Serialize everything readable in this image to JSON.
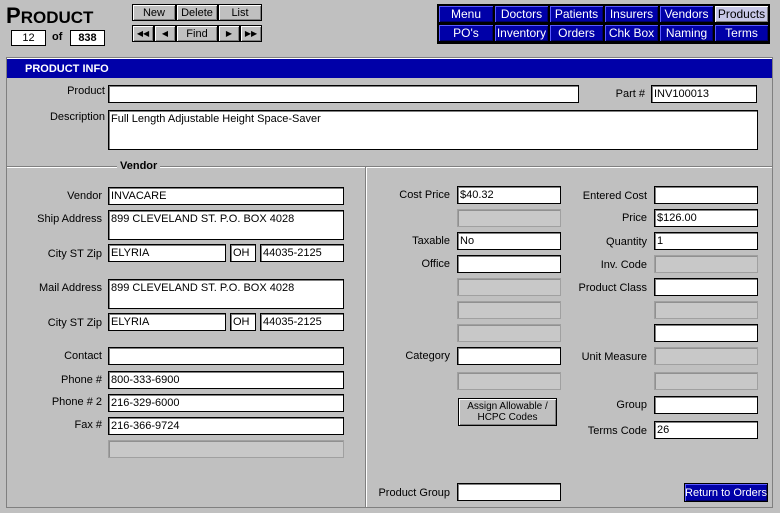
{
  "app": {
    "title_initial": "P",
    "title_rest": "RODUCT"
  },
  "record": {
    "current": "12",
    "of_label": "of",
    "total": "838"
  },
  "toolbar": {
    "new_label": "New",
    "delete_label": "Delete",
    "list_label": "List",
    "first_label": "◀◀",
    "prev_label": "◀",
    "find_label": "Find",
    "next_label": "▶",
    "last_label": "▶▶"
  },
  "nav": {
    "row1": [
      "Menu",
      "Doctors",
      "Patients",
      "Insurers",
      "Vendors",
      "Products"
    ],
    "row2": [
      "PO's",
      "Inventory",
      "Orders",
      "Chk Box",
      "Naming",
      "Terms"
    ],
    "active": "Products"
  },
  "section_title": "PRODUCT INFO",
  "product": {
    "product_label": "Product",
    "product_value": "",
    "part_label": "Part #",
    "part_value": "INV100013",
    "description_label": "Description",
    "description_value": "Full Length Adjustable Height Space-Saver"
  },
  "vendor": {
    "group_title": "Vendor",
    "vendor_label": "Vendor",
    "vendor_value": "INVACARE",
    "ship_label": "Ship Address",
    "ship_value": "899 CLEVELAND ST. P.O. BOX 4028",
    "city1_label": "City ST Zip",
    "city1": "ELYRIA",
    "st1": "OH",
    "zip1": "44035-2125",
    "mail_label": "Mail Address",
    "mail_value": "899 CLEVELAND ST. P.O. BOX 4028",
    "city2_label": "City ST Zip",
    "city2": "ELYRIA",
    "st2": "OH",
    "zip2": "44035-2125",
    "contact_label": "Contact",
    "contact_value": "",
    "phone_label": "Phone #",
    "phone_value": "800-333-6900",
    "phone2_label": "Phone # 2",
    "phone2_value": "216-329-6000",
    "fax_label": "Fax #",
    "fax_value": "216-366-9724"
  },
  "pricing": {
    "cost_price_label": "Cost Price",
    "cost_price_value": "$40.32",
    "taxable_label": "Taxable",
    "taxable_value": "No",
    "office_label": "Office",
    "office_value": "",
    "category_label": "Category",
    "category_value": "",
    "assign_line1": "Assign Allowable /",
    "assign_line2": "HCPC Codes",
    "product_group_label": "Product Group",
    "product_group_value": "",
    "entered_cost_label": "Entered Cost",
    "entered_cost_value": "",
    "price_label": "Price",
    "price_value": "$126.00",
    "quantity_label": "Quantity",
    "quantity_value": "1",
    "inv_code_label": "Inv. Code",
    "inv_code_value": "",
    "product_class_label": "Product Class",
    "product_class_value": "",
    "unit_measure_label": "Unit Measure",
    "unit_measure_value": "",
    "group_label": "Group",
    "group_value": "",
    "terms_code_label": "Terms Code",
    "terms_code_value": "26"
  },
  "return_label": "Return to Orders"
}
